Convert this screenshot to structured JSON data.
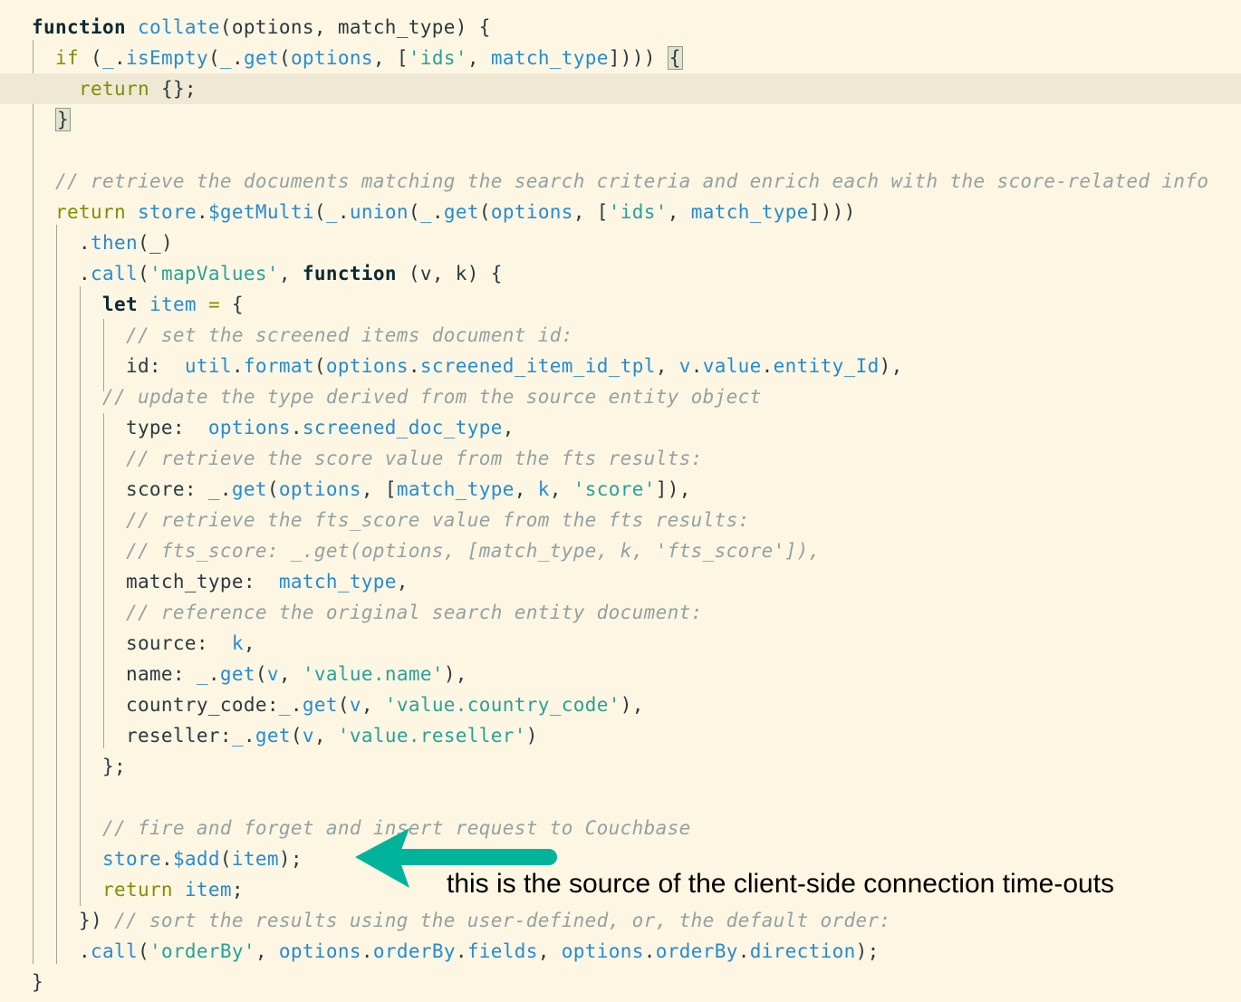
{
  "code": {
    "lines": [
      [
        {
          "c": "kw",
          "t": "function"
        },
        {
          "c": "p",
          "t": " "
        },
        {
          "c": "id",
          "t": "collate"
        },
        {
          "c": "p",
          "t": "(options, match_type) {"
        }
      ],
      [
        {
          "c": "p",
          "t": "  "
        },
        {
          "c": "kwg",
          "t": "if"
        },
        {
          "c": "p",
          "t": " ("
        },
        {
          "c": "id",
          "t": "_"
        },
        {
          "c": "p",
          "t": "."
        },
        {
          "c": "id",
          "t": "isEmpty"
        },
        {
          "c": "p",
          "t": "("
        },
        {
          "c": "id",
          "t": "_"
        },
        {
          "c": "p",
          "t": "."
        },
        {
          "c": "id",
          "t": "get"
        },
        {
          "c": "p",
          "t": "("
        },
        {
          "c": "id",
          "t": "options"
        },
        {
          "c": "p",
          "t": ", ["
        },
        {
          "c": "str",
          "t": "'ids'"
        },
        {
          "c": "p",
          "t": ", "
        },
        {
          "c": "id",
          "t": "match_type"
        },
        {
          "c": "p",
          "t": "]))) "
        },
        {
          "c": "bracket-box",
          "t": "{"
        }
      ],
      [
        {
          "c": "p",
          "t": "    "
        },
        {
          "c": "kwg",
          "t": "return"
        },
        {
          "c": "p",
          "t": " {};"
        }
      ],
      [
        {
          "c": "p",
          "t": "  "
        },
        {
          "c": "bracket-box",
          "t": "}"
        }
      ],
      [],
      [
        {
          "c": "p",
          "t": "  "
        },
        {
          "c": "cm",
          "t": "// retrieve the documents matching the search criteria and enrich each with the score-related info"
        }
      ],
      [
        {
          "c": "p",
          "t": "  "
        },
        {
          "c": "kwg",
          "t": "return"
        },
        {
          "c": "p",
          "t": " "
        },
        {
          "c": "id",
          "t": "store"
        },
        {
          "c": "p",
          "t": "."
        },
        {
          "c": "id",
          "t": "$getMulti"
        },
        {
          "c": "p",
          "t": "("
        },
        {
          "c": "id",
          "t": "_"
        },
        {
          "c": "p",
          "t": "."
        },
        {
          "c": "id",
          "t": "union"
        },
        {
          "c": "p",
          "t": "("
        },
        {
          "c": "id",
          "t": "_"
        },
        {
          "c": "p",
          "t": "."
        },
        {
          "c": "id",
          "t": "get"
        },
        {
          "c": "p",
          "t": "("
        },
        {
          "c": "id",
          "t": "options"
        },
        {
          "c": "p",
          "t": ", ["
        },
        {
          "c": "str",
          "t": "'ids'"
        },
        {
          "c": "p",
          "t": ", "
        },
        {
          "c": "id",
          "t": "match_type"
        },
        {
          "c": "p",
          "t": "])))"
        }
      ],
      [
        {
          "c": "p",
          "t": "    ."
        },
        {
          "c": "id",
          "t": "then"
        },
        {
          "c": "p",
          "t": "(_)"
        }
      ],
      [
        {
          "c": "p",
          "t": "    ."
        },
        {
          "c": "id",
          "t": "call"
        },
        {
          "c": "p",
          "t": "("
        },
        {
          "c": "str",
          "t": "'mapValues'"
        },
        {
          "c": "p",
          "t": ", "
        },
        {
          "c": "kw",
          "t": "function"
        },
        {
          "c": "p",
          "t": " (v, k) {"
        }
      ],
      [
        {
          "c": "p",
          "t": "      "
        },
        {
          "c": "kw",
          "t": "let"
        },
        {
          "c": "p",
          "t": " "
        },
        {
          "c": "id",
          "t": "item"
        },
        {
          "c": "p",
          "t": " "
        },
        {
          "c": "kwg",
          "t": "="
        },
        {
          "c": "p",
          "t": " {"
        }
      ],
      [
        {
          "c": "p",
          "t": "        "
        },
        {
          "c": "cm",
          "t": "// set the screened items document id:"
        }
      ],
      [
        {
          "c": "p",
          "t": "        id:  "
        },
        {
          "c": "id",
          "t": "util"
        },
        {
          "c": "p",
          "t": "."
        },
        {
          "c": "id",
          "t": "format"
        },
        {
          "c": "p",
          "t": "("
        },
        {
          "c": "id",
          "t": "options"
        },
        {
          "c": "p",
          "t": "."
        },
        {
          "c": "id",
          "t": "screened_item_id_tpl"
        },
        {
          "c": "p",
          "t": ", "
        },
        {
          "c": "id",
          "t": "v"
        },
        {
          "c": "p",
          "t": "."
        },
        {
          "c": "id",
          "t": "value"
        },
        {
          "c": "p",
          "t": "."
        },
        {
          "c": "id",
          "t": "entity_Id"
        },
        {
          "c": "p",
          "t": "),"
        }
      ],
      [
        {
          "c": "p",
          "t": "      "
        },
        {
          "c": "cm",
          "t": "// update the type derived from the source entity object"
        }
      ],
      [
        {
          "c": "p",
          "t": "        type:  "
        },
        {
          "c": "id",
          "t": "options"
        },
        {
          "c": "p",
          "t": "."
        },
        {
          "c": "id",
          "t": "screened_doc_type"
        },
        {
          "c": "p",
          "t": ","
        }
      ],
      [
        {
          "c": "p",
          "t": "        "
        },
        {
          "c": "cm",
          "t": "// retrieve the score value from the fts results:"
        }
      ],
      [
        {
          "c": "p",
          "t": "        score: "
        },
        {
          "c": "id",
          "t": "_"
        },
        {
          "c": "p",
          "t": "."
        },
        {
          "c": "id",
          "t": "get"
        },
        {
          "c": "p",
          "t": "("
        },
        {
          "c": "id",
          "t": "options"
        },
        {
          "c": "p",
          "t": ", ["
        },
        {
          "c": "id",
          "t": "match_type"
        },
        {
          "c": "p",
          "t": ", "
        },
        {
          "c": "id",
          "t": "k"
        },
        {
          "c": "p",
          "t": ", "
        },
        {
          "c": "str",
          "t": "'score'"
        },
        {
          "c": "p",
          "t": "]),"
        }
      ],
      [
        {
          "c": "p",
          "t": "        "
        },
        {
          "c": "cm",
          "t": "// retrieve the fts_score value from the fts results:"
        }
      ],
      [
        {
          "c": "p",
          "t": "        "
        },
        {
          "c": "cm",
          "t": "// fts_score: _.get(options, [match_type, k, 'fts_score']),"
        }
      ],
      [
        {
          "c": "p",
          "t": "        match_type:  "
        },
        {
          "c": "id",
          "t": "match_type"
        },
        {
          "c": "p",
          "t": ","
        }
      ],
      [
        {
          "c": "p",
          "t": "        "
        },
        {
          "c": "cm",
          "t": "// reference the original search entity document:"
        }
      ],
      [
        {
          "c": "p",
          "t": "        source:  "
        },
        {
          "c": "id",
          "t": "k"
        },
        {
          "c": "p",
          "t": ","
        }
      ],
      [
        {
          "c": "p",
          "t": "        name: "
        },
        {
          "c": "id",
          "t": "_"
        },
        {
          "c": "p",
          "t": "."
        },
        {
          "c": "id",
          "t": "get"
        },
        {
          "c": "p",
          "t": "("
        },
        {
          "c": "id",
          "t": "v"
        },
        {
          "c": "p",
          "t": ", "
        },
        {
          "c": "str",
          "t": "'value.name'"
        },
        {
          "c": "p",
          "t": "),"
        }
      ],
      [
        {
          "c": "p",
          "t": "        country_code:"
        },
        {
          "c": "id",
          "t": "_"
        },
        {
          "c": "p",
          "t": "."
        },
        {
          "c": "id",
          "t": "get"
        },
        {
          "c": "p",
          "t": "("
        },
        {
          "c": "id",
          "t": "v"
        },
        {
          "c": "p",
          "t": ", "
        },
        {
          "c": "str",
          "t": "'value.country_code'"
        },
        {
          "c": "p",
          "t": "),"
        }
      ],
      [
        {
          "c": "p",
          "t": "        reseller:"
        },
        {
          "c": "id",
          "t": "_"
        },
        {
          "c": "p",
          "t": "."
        },
        {
          "c": "id",
          "t": "get"
        },
        {
          "c": "p",
          "t": "("
        },
        {
          "c": "id",
          "t": "v"
        },
        {
          "c": "p",
          "t": ", "
        },
        {
          "c": "str",
          "t": "'value.reseller'"
        },
        {
          "c": "p",
          "t": ")"
        }
      ],
      [
        {
          "c": "p",
          "t": "      };"
        }
      ],
      [],
      [
        {
          "c": "p",
          "t": "      "
        },
        {
          "c": "cm",
          "t": "// fire and forget and insert request to Couchbase"
        }
      ],
      [
        {
          "c": "p",
          "t": "      "
        },
        {
          "c": "id",
          "t": "store"
        },
        {
          "c": "p",
          "t": "."
        },
        {
          "c": "id",
          "t": "$add"
        },
        {
          "c": "p",
          "t": "("
        },
        {
          "c": "id",
          "t": "item"
        },
        {
          "c": "p",
          "t": ");"
        }
      ],
      [
        {
          "c": "p",
          "t": "      "
        },
        {
          "c": "kwg",
          "t": "return"
        },
        {
          "c": "p",
          "t": " "
        },
        {
          "c": "id",
          "t": "item"
        },
        {
          "c": "p",
          "t": ";"
        }
      ],
      [
        {
          "c": "p",
          "t": "    }) "
        },
        {
          "c": "cm",
          "t": "// sort the results using the user-defined, or, the default order:"
        }
      ],
      [
        {
          "c": "p",
          "t": "    ."
        },
        {
          "c": "id",
          "t": "call"
        },
        {
          "c": "p",
          "t": "("
        },
        {
          "c": "str",
          "t": "'orderBy'"
        },
        {
          "c": "p",
          "t": ", "
        },
        {
          "c": "id",
          "t": "options"
        },
        {
          "c": "p",
          "t": "."
        },
        {
          "c": "id",
          "t": "orderBy"
        },
        {
          "c": "p",
          "t": "."
        },
        {
          "c": "id",
          "t": "fields"
        },
        {
          "c": "p",
          "t": ", "
        },
        {
          "c": "id",
          "t": "options"
        },
        {
          "c": "p",
          "t": "."
        },
        {
          "c": "id",
          "t": "orderBy"
        },
        {
          "c": "p",
          "t": "."
        },
        {
          "c": "id",
          "t": "direction"
        },
        {
          "c": "p",
          "t": ");"
        }
      ],
      [
        {
          "c": "p",
          "t": "}"
        }
      ]
    ],
    "highlighted_line": 2
  },
  "annotation": {
    "text": "this is the source of the client-side connection time-outs",
    "arrow_color": "#00b39b",
    "arrow_direction": "left"
  },
  "colors": {
    "background": "#fdf6e3",
    "current_line": "#eee8d5",
    "keyword": "#0b2a33",
    "keyword_green": "#7f8f00",
    "identifier": "#268bd2",
    "string": "#2aa198",
    "comment": "#93a1a1"
  }
}
